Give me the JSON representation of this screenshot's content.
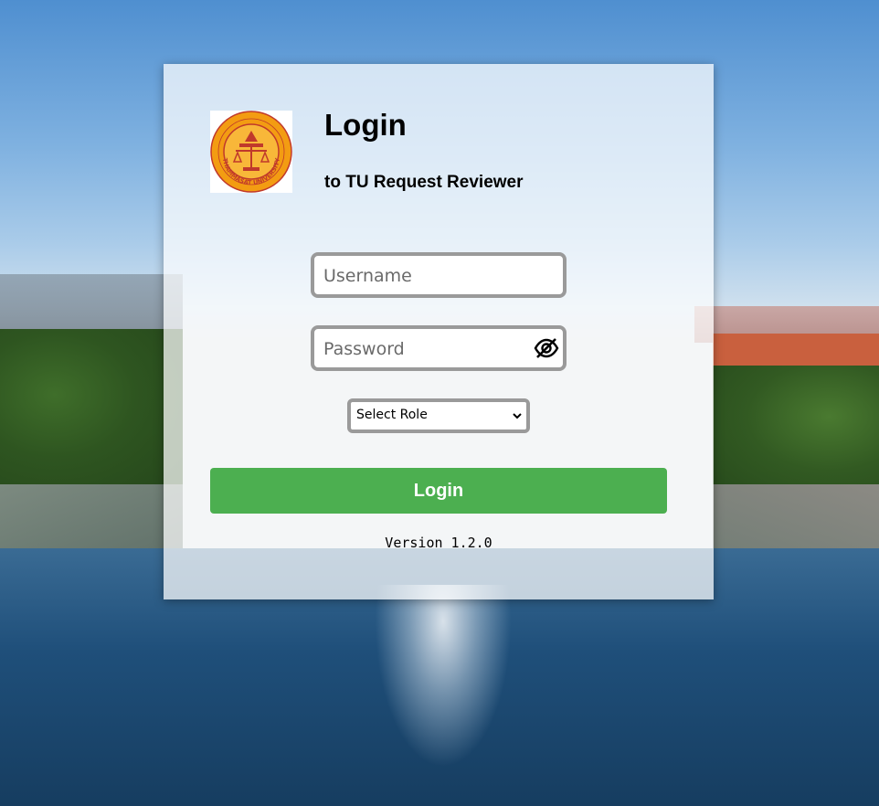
{
  "login": {
    "title": "Login",
    "subtitle": "to TU Request Reviewer",
    "logo_icon": "thammasat-university-seal",
    "logo_text": "THAMMASAT UNIVERSITY",
    "username": {
      "placeholder": "Username",
      "value": ""
    },
    "password": {
      "placeholder": "Password",
      "value": "",
      "toggle_icon": "eye-slash-icon"
    },
    "role": {
      "selected": "Select Role"
    },
    "submit_label": "Login",
    "version": "Version 1.2.0"
  },
  "colors": {
    "button": "#4caf50",
    "field_border": "#9a9a9a",
    "seal": "#f39c12",
    "seal_accent": "#c0392b"
  }
}
